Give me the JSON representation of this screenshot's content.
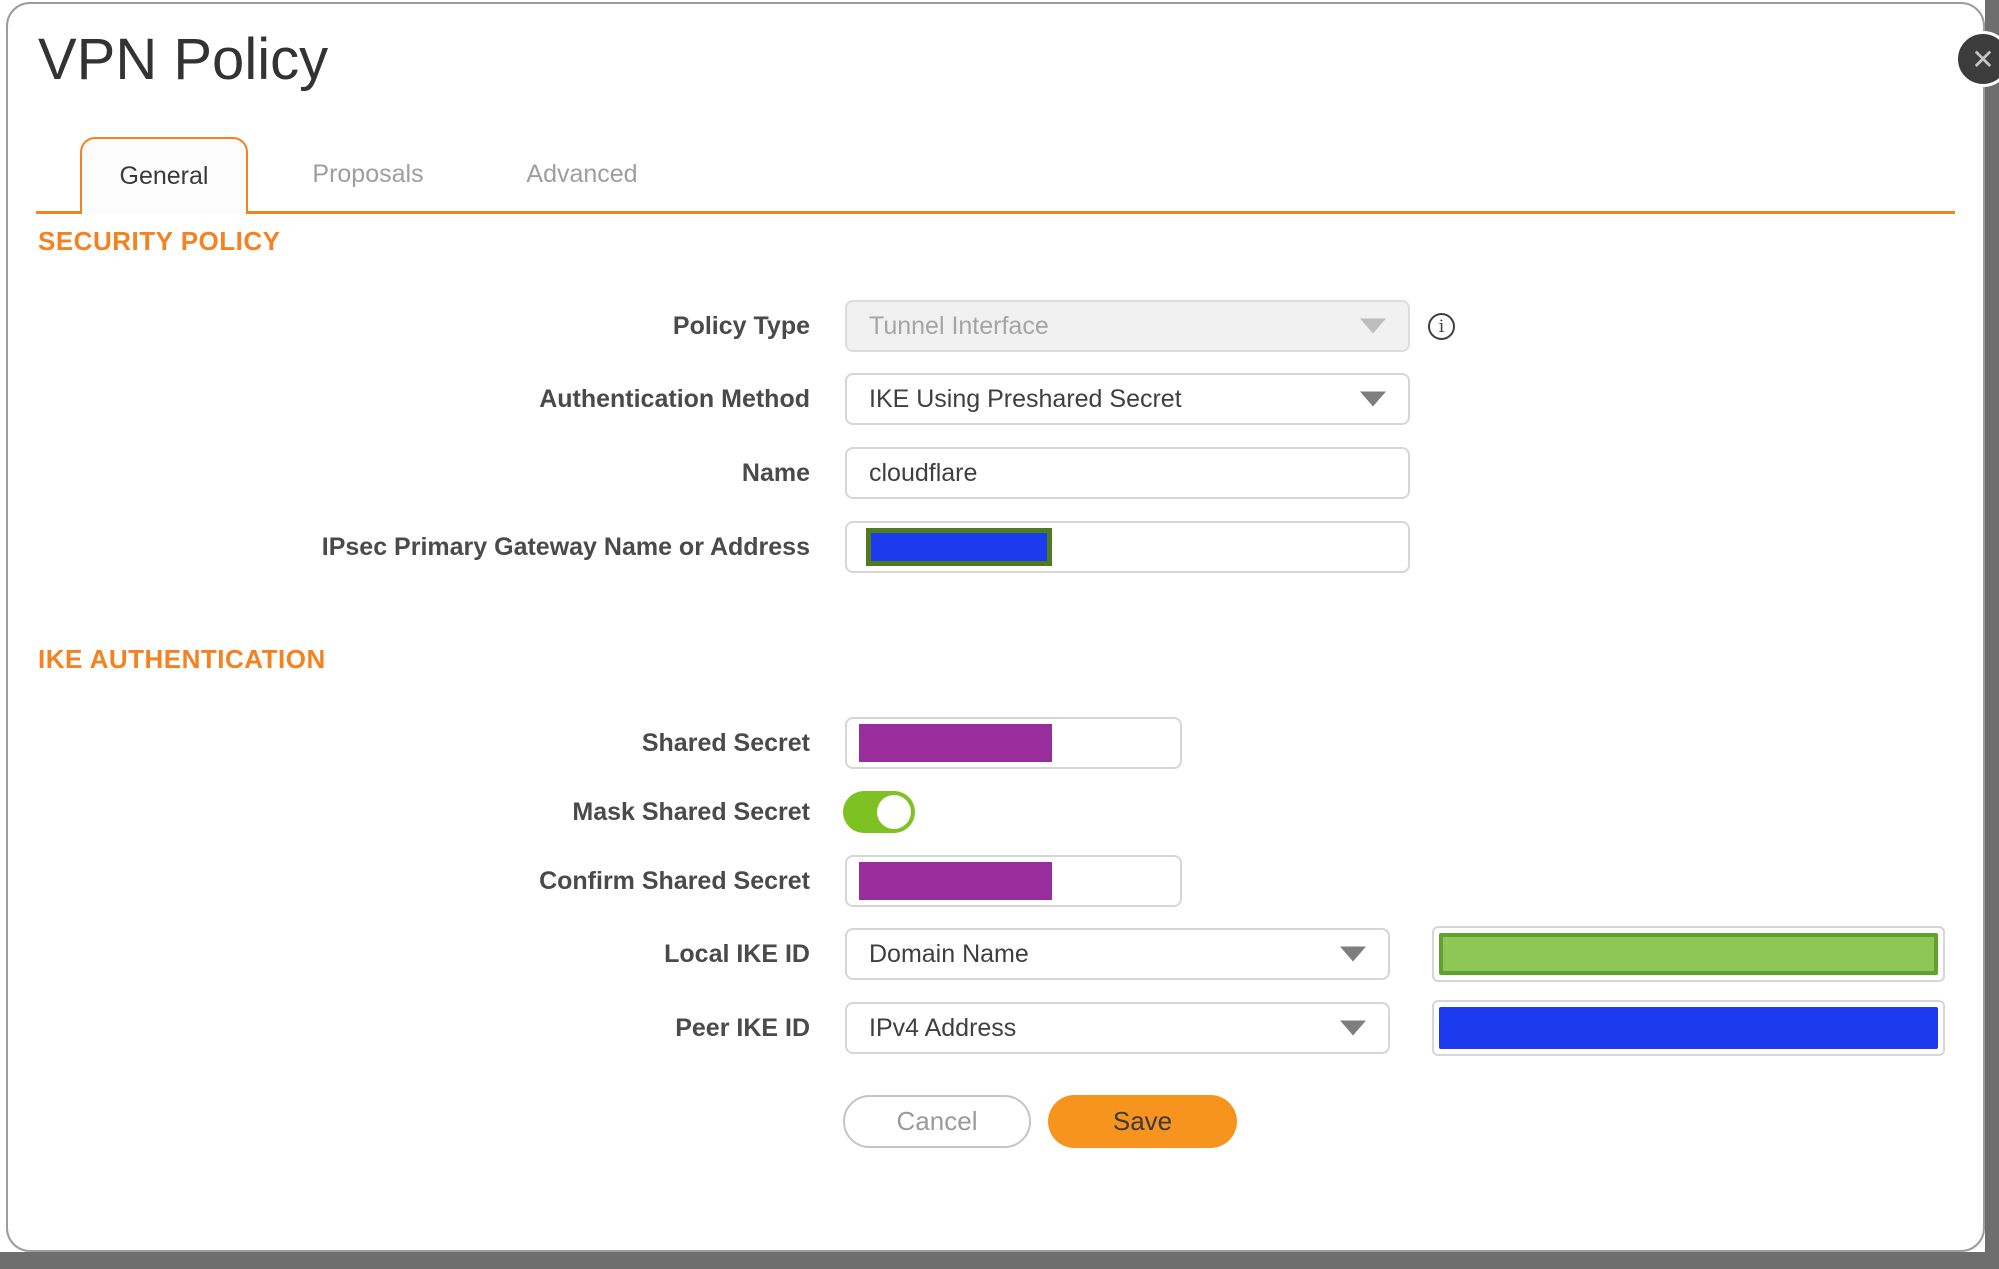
{
  "window": {
    "title": "VPN Policy"
  },
  "icons": {
    "close": "✕",
    "info": "i"
  },
  "tabs": [
    {
      "label": "General",
      "active": true
    },
    {
      "label": "Proposals",
      "active": false
    },
    {
      "label": "Advanced",
      "active": false
    }
  ],
  "sections": {
    "security_policy": "SECURITY POLICY",
    "ike_authentication": "IKE AUTHENTICATION"
  },
  "fields": {
    "policy_type": {
      "label": "Policy Type",
      "value": "Tunnel Interface",
      "disabled": true
    },
    "authentication_method": {
      "label": "Authentication Method",
      "value": "IKE Using Preshared Secret"
    },
    "name": {
      "label": "Name",
      "value": "cloudflare"
    },
    "ipsec_gateway": {
      "label": "IPsec Primary Gateway Name or Address",
      "value_redacted": "blue-box"
    },
    "shared_secret": {
      "label": "Shared Secret",
      "value_redacted": "purple-box"
    },
    "mask_shared_secret": {
      "label": "Mask Shared Secret",
      "state": "on"
    },
    "confirm_shared_secret": {
      "label": "Confirm Shared Secret",
      "value_redacted": "purple-box"
    },
    "local_ike_id": {
      "label": "Local IKE ID",
      "value": "Domain Name",
      "extra_redacted": "green-box"
    },
    "peer_ike_id": {
      "label": "Peer IKE ID",
      "value": "IPv4 Address",
      "extra_redacted": "blue-box"
    }
  },
  "buttons": {
    "cancel": "Cancel",
    "save": "Save"
  },
  "colors": {
    "accent_orange": "#F58220",
    "save_orange": "#F7941E",
    "redaction_purple": "#9A2D9D",
    "redaction_blue": "#1D3BEE",
    "redaction_green_fill": "#8DC856",
    "redaction_green_border": "#61A22E",
    "gateway_redaction_border": "#4F7B1E",
    "toggle_green": "#7DC122",
    "backdrop_gray": "#6E6E6E"
  }
}
